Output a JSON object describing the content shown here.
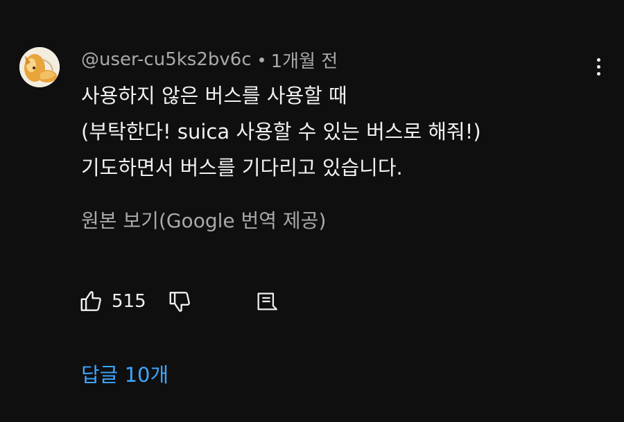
{
  "comment": {
    "author": "@user-cu5ks2bv6c",
    "timestamp": "1개월 전",
    "avatar_icon": "avatar-fox-icon",
    "body_lines": [
      "사용하지 않은 버스를 사용할 때",
      "(부탁한다! suica 사용할 수 있는 버스로 해줘!)",
      "기도하면서 버스를 기다리고 있습니다."
    ],
    "translation_link": "원본 보기(Google 번역 제공)",
    "actions": {
      "like_icon": "thumbs-up-icon",
      "like_count": "515",
      "dislike_icon": "thumbs-down-icon",
      "reply_icon": "reply-icon"
    },
    "replies_label": "답글 10개",
    "menu_icon": "more-vertical-icon"
  },
  "colors": {
    "background": "#0f0f0f",
    "primary_text": "#f1f1f1",
    "secondary_text": "#aaaaaa",
    "link_blue": "#3ea6ff"
  }
}
